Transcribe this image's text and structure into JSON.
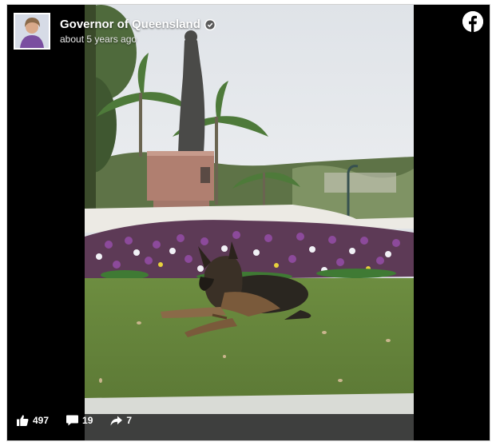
{
  "post": {
    "page_name": "Governor of Queensland",
    "timestamp": "about 5 years ago",
    "verified": true
  },
  "stats": {
    "likes": "497",
    "comments": "19",
    "shares": "7"
  },
  "colors": {
    "background": "#000000",
    "text": "#ffffff",
    "facebook_logo_bg": "#ffffff"
  },
  "icons": {
    "like": "thumbs-up-icon",
    "comment": "speech-bubble-icon",
    "share": "share-arrow-icon",
    "brand": "facebook-icon",
    "verified": "verified-check-icon"
  }
}
